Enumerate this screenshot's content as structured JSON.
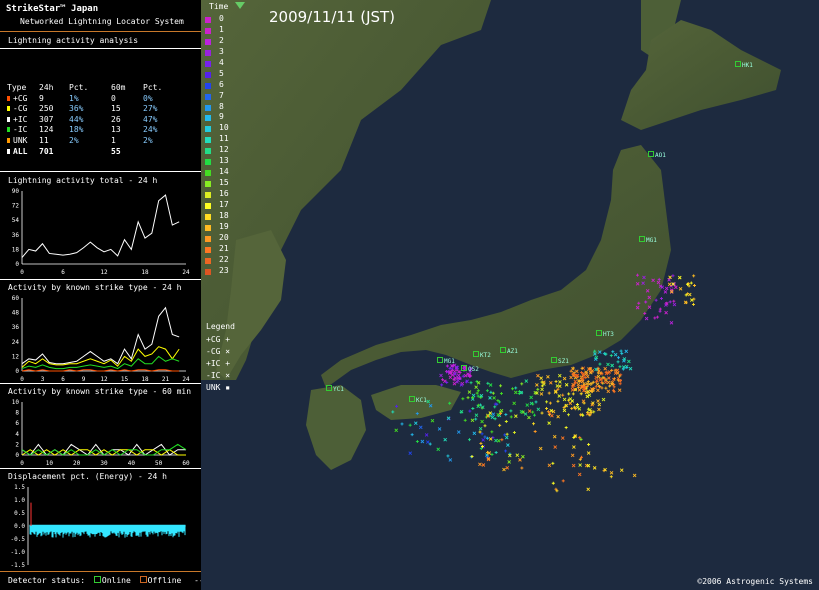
{
  "header": {
    "title": "StrikeStar™ Japan",
    "subtitle": "Networked Lightning Locator System"
  },
  "sections": {
    "analysis": "Lightning activity analysis",
    "total24": "Lightning activity total - 24 h",
    "type24": "Activity by known strike type - 24 h",
    "type60": "Activity by known strike type - 60 min",
    "displacement": "Displacement pct. (Energy) - 24 h"
  },
  "stats": {
    "headers": [
      "Type",
      "24h",
      "Pct.",
      "60m",
      "Pct."
    ],
    "rows": [
      {
        "type": "+CG",
        "h24": "9",
        "p24": "1%",
        "m60": "0",
        "p60": "0%",
        "color": "#ff5000"
      },
      {
        "type": "-CG",
        "h24": "250",
        "p24": "36%",
        "m60": "15",
        "p60": "27%",
        "color": "#ffff00"
      },
      {
        "type": "+IC",
        "h24": "307",
        "p24": "44%",
        "m60": "26",
        "p60": "47%",
        "color": "#ffffff"
      },
      {
        "type": "-IC",
        "h24": "124",
        "p24": "18%",
        "m60": "13",
        "p60": "24%",
        "color": "#22dd22"
      },
      {
        "type": "UNK",
        "h24": "11",
        "p24": "2%",
        "m60": "1",
        "p60": "2%",
        "color": "#ff9900"
      },
      {
        "type": "ALL",
        "h24": "701",
        "p24": "",
        "m60": "55",
        "p60": "",
        "color": "#ffffff"
      }
    ]
  },
  "chart_data": [
    {
      "type": "line",
      "title": "Lightning activity total - 24 h",
      "x": [
        0,
        1,
        2,
        3,
        4,
        5,
        6,
        7,
        8,
        9,
        10,
        11,
        12,
        13,
        14,
        15,
        16,
        17,
        18,
        19,
        20,
        21,
        22,
        23
      ],
      "series": [
        {
          "values": [
            8,
            18,
            16,
            25,
            13,
            12,
            11,
            12,
            14,
            20,
            27,
            20,
            15,
            18,
            10,
            30,
            18,
            52,
            32,
            38,
            78,
            85,
            48,
            52
          ]
        }
      ],
      "xticks": [
        "0",
        "6",
        "12",
        "18",
        "24"
      ],
      "yticks": [
        "0",
        "18",
        "36",
        "54",
        "72",
        "90"
      ],
      "ylim": [
        0,
        90
      ],
      "xlim": [
        0,
        24
      ]
    },
    {
      "type": "line",
      "title": "Activity by known strike type - 24 h",
      "x": [
        0,
        1,
        2,
        3,
        4,
        5,
        6,
        7,
        8,
        9,
        10,
        11,
        12,
        13,
        14,
        15,
        16,
        17,
        18,
        19,
        20,
        21,
        22,
        23
      ],
      "series": [
        {
          "values": [
            6,
            10,
            9,
            14,
            7,
            6,
            6,
            7,
            8,
            12,
            16,
            12,
            8,
            10,
            6,
            18,
            10,
            30,
            18,
            22,
            45,
            52,
            30,
            28
          ],
          "color": "#ffffff"
        },
        {
          "values": [
            3,
            8,
            6,
            10,
            6,
            5,
            5,
            6,
            6,
            8,
            10,
            8,
            6,
            9,
            4,
            12,
            8,
            18,
            12,
            14,
            20,
            18,
            10,
            18
          ],
          "color": "#ffff00"
        },
        {
          "values": [
            2,
            4,
            3,
            5,
            3,
            2,
            2,
            3,
            3,
            4,
            5,
            4,
            3,
            4,
            2,
            6,
            4,
            10,
            6,
            6,
            12,
            8,
            10,
            8
          ],
          "color": "#22dd22"
        },
        {
          "values": [
            0,
            1,
            0,
            1,
            0,
            0,
            0,
            1,
            0,
            1,
            1,
            0,
            0,
            1,
            0,
            1,
            0,
            1,
            1,
            0,
            1,
            1,
            0,
            0
          ],
          "color": "#ff5000"
        }
      ],
      "xticks": [
        "0",
        "3",
        "6",
        "9",
        "12",
        "15",
        "18",
        "21",
        "24"
      ],
      "yticks": [
        "0",
        "12",
        "24",
        "36",
        "48",
        "60"
      ],
      "ylim": [
        0,
        60
      ],
      "xlim": [
        0,
        24
      ]
    },
    {
      "type": "line",
      "title": "Activity by known strike type - 60 min",
      "x": [
        0,
        3,
        6,
        9,
        12,
        15,
        18,
        21,
        24,
        27,
        30,
        33,
        36,
        39,
        42,
        45,
        48,
        51,
        54,
        57,
        60
      ],
      "series": [
        {
          "values": [
            1,
            0,
            2,
            0,
            1,
            0,
            2,
            1,
            0,
            2,
            0,
            1,
            1,
            0,
            2,
            0,
            1,
            2,
            0,
            1,
            1
          ],
          "color": "#ffffff"
        },
        {
          "values": [
            0,
            1,
            0,
            1,
            0,
            1,
            0,
            1,
            1,
            0,
            1,
            0,
            1,
            1,
            0,
            1,
            1,
            0,
            1,
            0,
            0
          ],
          "color": "#ffff00"
        },
        {
          "values": [
            1,
            0,
            1,
            0,
            1,
            0,
            1,
            0,
            0,
            1,
            0,
            1,
            0,
            1,
            1,
            0,
            0,
            1,
            1,
            2,
            1
          ],
          "color": "#22dd22"
        }
      ],
      "xticks": [
        "0",
        "10",
        "20",
        "30",
        "40",
        "50",
        "60"
      ],
      "yticks": [
        "0",
        "2",
        "4",
        "6",
        "8",
        "10"
      ],
      "ylim": [
        0,
        10
      ],
      "xlim": [
        0,
        60
      ]
    },
    {
      "type": "bar",
      "title": "Displacement pct. (Energy) - 24 h",
      "yticks": [
        "-1.5",
        "-1.0",
        "-0.5",
        "0.0",
        "0.5",
        "1.0",
        "1.5"
      ],
      "ylim": [
        -1.5,
        1.5
      ]
    }
  ],
  "map": {
    "date": "2009/11/11 (JST)",
    "time_title": "Time",
    "hours": [
      {
        "label": "0",
        "color": "#cc22cc"
      },
      {
        "label": "1",
        "color": "#cc22cc"
      },
      {
        "label": "2",
        "color": "#bb22dd"
      },
      {
        "label": "3",
        "color": "#9922dd"
      },
      {
        "label": "4",
        "color": "#7722ee"
      },
      {
        "label": "5",
        "color": "#5522ee"
      },
      {
        "label": "6",
        "color": "#2244ee"
      },
      {
        "label": "7",
        "color": "#2266ee"
      },
      {
        "label": "8",
        "color": "#2299ee"
      },
      {
        "label": "9",
        "color": "#22bbee"
      },
      {
        "label": "10",
        "color": "#22ccdd"
      },
      {
        "label": "11",
        "color": "#22ddbb"
      },
      {
        "label": "12",
        "color": "#22dd88"
      },
      {
        "label": "13",
        "color": "#22dd44"
      },
      {
        "label": "14",
        "color": "#44dd22"
      },
      {
        "label": "15",
        "color": "#88ee22"
      },
      {
        "label": "16",
        "color": "#ddee22"
      },
      {
        "label": "17",
        "color": "#ffff22"
      },
      {
        "label": "18",
        "color": "#ffdd22"
      },
      {
        "label": "19",
        "color": "#ffbb22"
      },
      {
        "label": "20",
        "color": "#ff9922"
      },
      {
        "label": "21",
        "color": "#ff7722"
      },
      {
        "label": "22",
        "color": "#ee6622"
      },
      {
        "label": "23",
        "color": "#dd5522"
      }
    ],
    "legend_title": "Legend",
    "legend": [
      {
        "label": "+CG",
        "sym": "+"
      },
      {
        "label": "-CG",
        "sym": "×"
      },
      {
        "label": "+IC",
        "sym": "+"
      },
      {
        "label": "-IC",
        "sym": "×"
      },
      {
        "label": "UNK",
        "sym": "▪"
      }
    ],
    "stations": [
      "HK1",
      "AO1",
      "MG1",
      "MG1",
      "KT2",
      "SZ1",
      "OS2",
      "AZ1",
      "YC1",
      "KC1",
      "HT3"
    ],
    "copyright": "©2006 Astrogenic Systems"
  },
  "status": {
    "label": "Detector status:",
    "online": "Online",
    "offline": "Offline",
    "arrow": "--->",
    "online_color": "#33cc33",
    "offline_color": "#cc6622"
  }
}
